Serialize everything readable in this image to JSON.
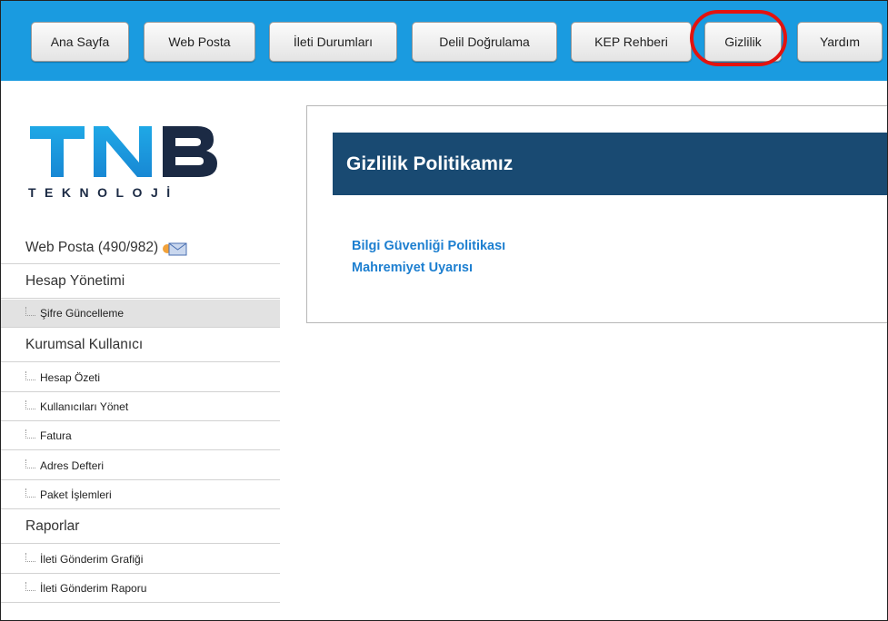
{
  "nav": {
    "items": [
      {
        "label": "Ana Sayfa"
      },
      {
        "label": "Web Posta"
      },
      {
        "label": "İleti Durumları"
      },
      {
        "label": "Delil Doğrulama"
      },
      {
        "label": "KEP Rehberi"
      },
      {
        "label": "Gizlilik"
      },
      {
        "label": "Yardım"
      }
    ],
    "active": "Gizlilik"
  },
  "logo": {
    "letters": "TNB",
    "subtitle": "TEKNOLOJİ"
  },
  "sidebar": {
    "web_posta": "Web Posta (490/982)",
    "hesap_yonetimi": "Hesap Yönetimi",
    "sifre_guncelleme": "Şifre Güncelleme",
    "kurumsal_kullanici": "Kurumsal Kullanıcı",
    "hesap_ozeti": "Hesap Özeti",
    "kullanicilari_yonet": "Kullanıcıları Yönet",
    "fatura": "Fatura",
    "adres_defteri": "Adres Defteri",
    "paket_islemleri": "Paket İşlemleri",
    "raporlar": "Raporlar",
    "ileti_gonderim_grafigi": "İleti Gönderim Grafiği",
    "ileti_gonderim_raporu": "İleti Gönderim Raporu"
  },
  "main": {
    "title": "Gizlilik Politikamız",
    "links": [
      "Bilgi Güvenliği Politikası",
      "Mahremiyet Uyarısı"
    ]
  },
  "colors": {
    "topbar": "#1a9be0",
    "header": "#194a72",
    "link": "#1d7fd0",
    "highlight": "#e3130f",
    "logo_blue": "#1e9ee2",
    "logo_dark": "#1b2a44"
  }
}
